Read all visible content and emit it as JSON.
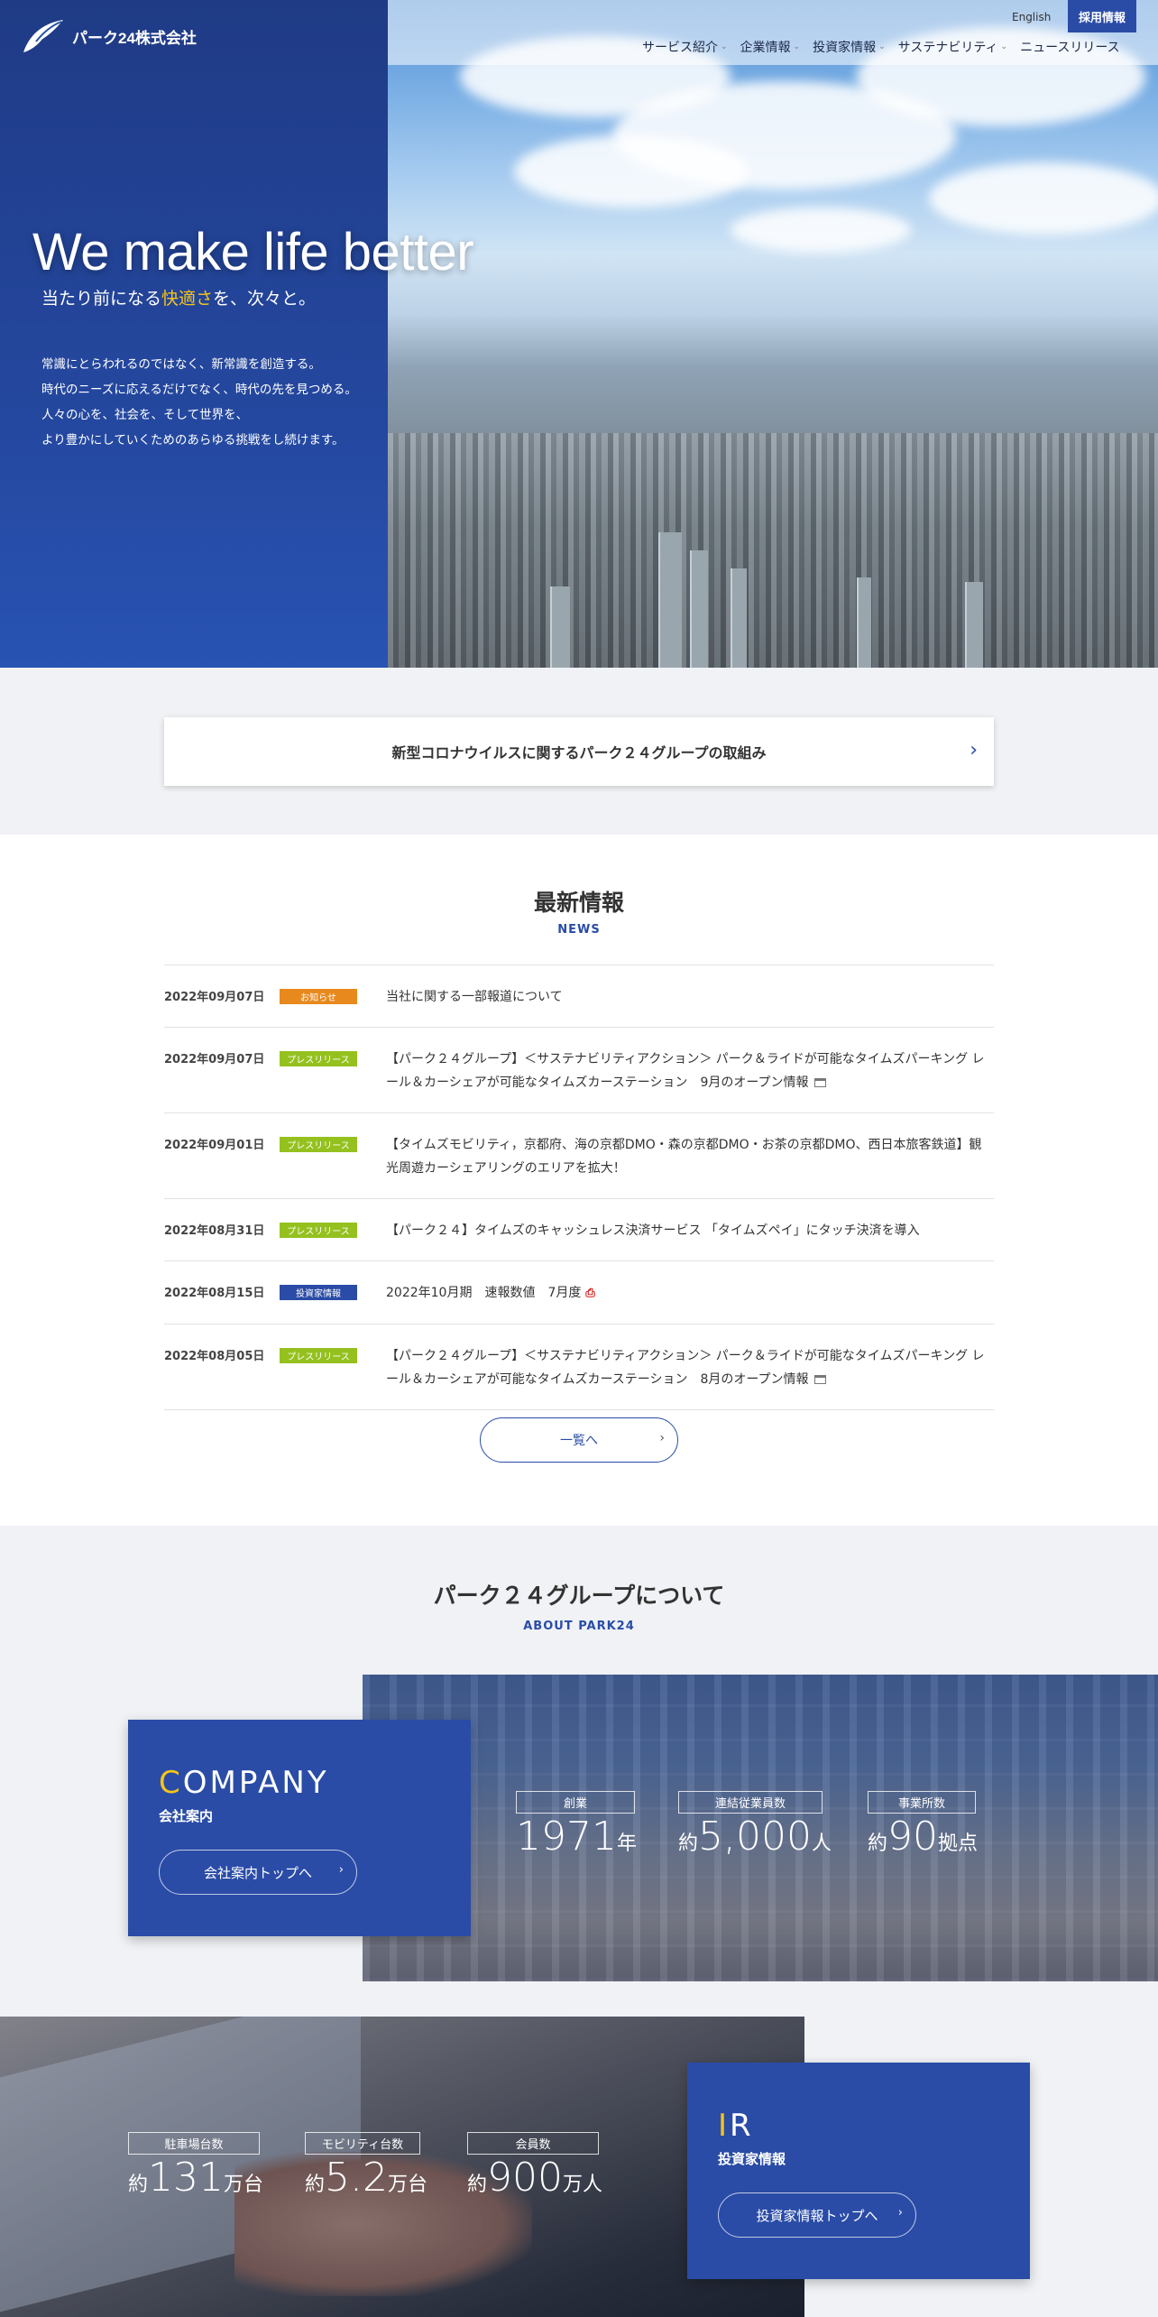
{
  "header": {
    "logo_text": "パーク24株式会社",
    "english_link": "English",
    "recruit_button": "採用情報",
    "nav": [
      {
        "label": "サービス紹介",
        "has_dropdown": true
      },
      {
        "label": "企業情報",
        "has_dropdown": true
      },
      {
        "label": "投資家情報",
        "has_dropdown": true
      },
      {
        "label": "サステナビリティ",
        "has_dropdown": true
      },
      {
        "label": "ニュースリリース",
        "has_dropdown": false
      }
    ]
  },
  "hero": {
    "title": "We make life better",
    "subtitle_before": "当たり前になる",
    "subtitle_accent": "快適さ",
    "subtitle_after": "を、次々と。",
    "body_lines": [
      "常識にとらわれるのではなく、新常識を創造する。",
      "時代のニーズに応えるだけでなく、時代の先を見つめる。",
      "人々の心を、社会を、そして世界を、",
      "より豊かにしていくためのあらゆる挑戦をし続けます。"
    ]
  },
  "covid": {
    "label": "新型コロナウイルスに関するパーク２４グループの取組み",
    "arrow": "›"
  },
  "news": {
    "title": "最新情報",
    "title_en": "NEWS",
    "items": [
      {
        "date": "2022年09月07日",
        "tag": "お知らせ",
        "tag_type": "info",
        "text": "当社に関する一部報道について",
        "icon": ""
      },
      {
        "date": "2022年09月07日",
        "tag": "プレスリリース",
        "tag_type": "press",
        "text": "【パーク２４グループ】＜サステナビリティアクション＞ パーク＆ライドが可能なタイムズパーキング レール＆カーシェアが可能なタイムズカーステーション　9月のオープン情報",
        "icon": "external"
      },
      {
        "date": "2022年09月01日",
        "tag": "プレスリリース",
        "tag_type": "press",
        "text": "【タイムズモビリティ，京都府、海の京都DMO・森の京都DMO・お茶の京都DMO、西日本旅客鉄道】観光周遊カーシェアリングのエリアを拡大！",
        "icon": ""
      },
      {
        "date": "2022年08月31日",
        "tag": "プレスリリース",
        "tag_type": "press",
        "text": "【パーク２４】タイムズのキャッシュレス決済サービス 「タイムズペイ」にタッチ決済を導入",
        "icon": ""
      },
      {
        "date": "2022年08月15日",
        "tag": "投資家情報",
        "tag_type": "ir",
        "text": "2022年10月期　速報数値　7月度",
        "icon": "pdf"
      },
      {
        "date": "2022年08月05日",
        "tag": "プレスリリース",
        "tag_type": "press",
        "text": "【パーク２４グループ】＜サステナビリティアクション＞ パーク＆ライドが可能なタイムズパーキング レール＆カーシェアが可能なタイムズカーステーション　8月のオープン情報",
        "icon": "external"
      }
    ],
    "more_button": "一覧へ",
    "more_arrow": "›"
  },
  "about": {
    "title": "パーク２４グループについて",
    "title_en": "ABOUT PARK24",
    "company": {
      "head_first": "C",
      "head_rest": "OMPANY",
      "sub": "会社案内",
      "button": "会社案内トップへ",
      "button_arrow": "›",
      "stats": [
        {
          "label": "創業",
          "prefix": "",
          "value": "1971",
          "suffix": "年"
        },
        {
          "label": "連結従業員数",
          "prefix": "約",
          "value": "5,000",
          "suffix": "人"
        },
        {
          "label": "事業所数",
          "prefix": "約",
          "value": "90",
          "suffix": "拠点"
        }
      ]
    },
    "ir": {
      "head_first": "I",
      "head_rest": "R",
      "sub": "投資家情報",
      "button": "投資家情報トップへ",
      "button_arrow": "›",
      "stats": [
        {
          "label": "駐車場台数",
          "prefix": "約",
          "value": "131",
          "suffix": "万台"
        },
        {
          "label": "モビリティ台数",
          "prefix": "約",
          "value": "5.2",
          "suffix": "万台"
        },
        {
          "label": "会員数",
          "prefix": "約",
          "value": "900",
          "suffix": "万人"
        }
      ]
    }
  }
}
